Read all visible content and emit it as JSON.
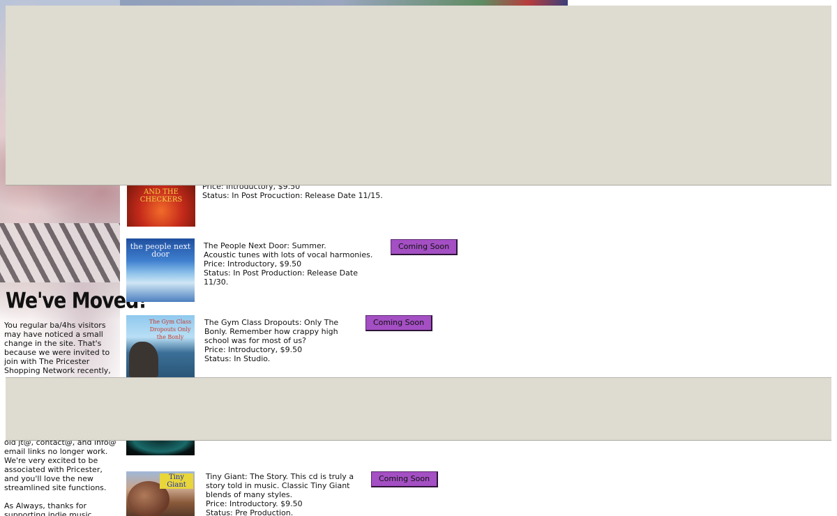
{
  "banner": {
    "colors": [
      "#8a9bb8",
      "#5f8b62",
      "#b83c3c",
      "#3a3f7a"
    ]
  },
  "broken_images": [
    "broken-image-icon",
    "broken-image-icon",
    "broken-image-icon"
  ],
  "sidebar": {
    "heading": "We've Moved!",
    "paragraphs": [
      "You regular ba/4hs visitors may have noticed a small change in the site. That's because we were invited to join with The Pricester Shopping Network recently,",
      "old jt@, contact@, and info@ email links no longer work. We're very excited to be associated with Pricester, and you'll love the new streamlined site functions.",
      "As Always, thanks for supporting indie music."
    ]
  },
  "products": [
    {
      "cover_text": "AND THE CHECKERS",
      "lines": [
        "Price: Introductory, $9.50",
        "Status: In Post Procuction: Release Date 11/15."
      ]
    },
    {
      "cover_text": "the people next door",
      "lines": [
        "The People Next Door: Summer.",
        "Acoustic tunes with lots of vocal harmonies.",
        "Price: Introductory, $9.50",
        "Status: In Post Production: Release Date",
        "11/30."
      ],
      "button": "Coming Soon"
    },
    {
      "cover_text": "The Gym Class Dropouts Only the Bonly",
      "lines": [
        "The Gym Class Dropouts: Only The",
        "Bonly. Remember how crappy high",
        "school was for most of us?",
        "Price: Introductory, $9.50",
        "Status: In Studio."
      ],
      "button": "Coming Soon"
    },
    {
      "cover_text": "",
      "lines": []
    },
    {
      "cover_text": "Tiny Giant",
      "lines": [
        "Tiny Giant: The Story. This cd is truly a",
        "story told in music. Classic Tiny Giant",
        "blends of many styles.",
        "Price: Introductory. $9.50",
        "Status: Pre Production."
      ],
      "button": "Coming Soon"
    }
  ],
  "colors": {
    "overlay": "#dedbd0",
    "button_bg": "#a44fc3",
    "link_border": "#9fb7d6"
  }
}
